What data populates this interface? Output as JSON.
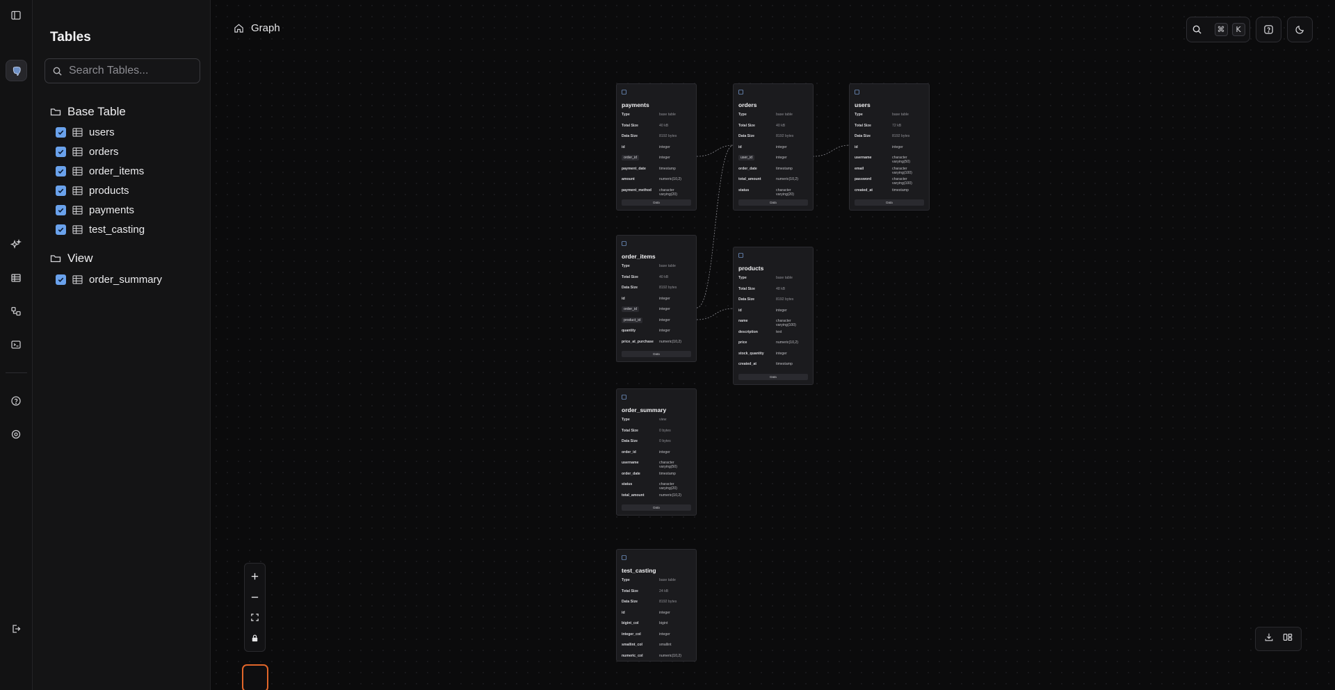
{
  "sidebar": {
    "title": "Tables",
    "search_placeholder": "Search Tables...",
    "groups": [
      {
        "label": "Base Table",
        "items": [
          "users",
          "orders",
          "order_items",
          "products",
          "payments",
          "test_casting"
        ]
      },
      {
        "label": "View",
        "items": [
          "order_summary"
        ]
      }
    ]
  },
  "rail": {
    "icons": [
      "sidebar-toggle-icon",
      "postgres-logo",
      "sparkles-icon",
      "table-icon",
      "schema-icon",
      "terminal-icon",
      "help-icon",
      "settings-icon",
      "logout-icon"
    ]
  },
  "breadcrumb": {
    "label": "Graph"
  },
  "toolbar": {
    "kbd_cmd": "⌘",
    "kbd_k": "K"
  },
  "nodes": {
    "payments": {
      "name": "payments",
      "rows": [
        [
          "Type",
          "base table"
        ],
        [
          "Total Size",
          "40 kB"
        ],
        [
          "Data Size",
          "8192 bytes"
        ],
        [
          "id",
          "integer"
        ],
        [
          "order_id",
          "integer"
        ],
        [
          "payment_date",
          "timestamp"
        ],
        [
          "amount",
          "numeric(10,2)"
        ],
        [
          "payment_method",
          "character varying(20)"
        ]
      ],
      "data_label": "Data"
    },
    "orders": {
      "name": "orders",
      "rows": [
        [
          "Type",
          "base table"
        ],
        [
          "Total Size",
          "40 kB"
        ],
        [
          "Data Size",
          "8192 bytes"
        ],
        [
          "id",
          "integer"
        ],
        [
          "user_id",
          "integer"
        ],
        [
          "order_date",
          "timestamp"
        ],
        [
          "total_amount",
          "numeric(10,2)"
        ],
        [
          "status",
          "character varying(20)"
        ]
      ],
      "data_label": "Data"
    },
    "users": {
      "name": "users",
      "rows": [
        [
          "Type",
          "base table"
        ],
        [
          "Total Size",
          "72 kB"
        ],
        [
          "Data Size",
          "8192 bytes"
        ],
        [
          "id",
          "integer"
        ],
        [
          "username",
          "character varying(50)"
        ],
        [
          "email",
          "character varying(100)"
        ],
        [
          "password",
          "character varying(100)"
        ],
        [
          "created_at",
          "timestamp"
        ]
      ],
      "data_label": "Data"
    },
    "order_items": {
      "name": "order_items",
      "rows": [
        [
          "Type",
          "base table"
        ],
        [
          "Total Size",
          "40 kB"
        ],
        [
          "Data Size",
          "8192 bytes"
        ],
        [
          "id",
          "integer"
        ],
        [
          "order_id",
          "integer"
        ],
        [
          "product_id",
          "integer"
        ],
        [
          "quantity",
          "integer"
        ],
        [
          "price_at_purchase",
          "numeric(10,2)"
        ]
      ],
      "data_label": "Data"
    },
    "products": {
      "name": "products",
      "rows": [
        [
          "Type",
          "base table"
        ],
        [
          "Total Size",
          "48 kB"
        ],
        [
          "Data Size",
          "8192 bytes"
        ],
        [
          "id",
          "integer"
        ],
        [
          "name",
          "character varying(100)"
        ],
        [
          "description",
          "text"
        ],
        [
          "price",
          "numeric(10,2)"
        ],
        [
          "stock_quantity",
          "integer"
        ],
        [
          "created_at",
          "timestamp"
        ]
      ],
      "data_label": "Data"
    },
    "order_summary": {
      "name": "order_summary",
      "rows": [
        [
          "Type",
          "view"
        ],
        [
          "Total Size",
          "0 bytes"
        ],
        [
          "Data Size",
          "0 bytes"
        ],
        [
          "order_id",
          "integer"
        ],
        [
          "username",
          "character varying(50)"
        ],
        [
          "order_date",
          "timestamp"
        ],
        [
          "status",
          "character varying(20)"
        ],
        [
          "total_amount",
          "numeric(10,2)"
        ]
      ],
      "data_label": "Data"
    },
    "test_casting": {
      "name": "test_casting",
      "rows": [
        [
          "Type",
          "base table"
        ],
        [
          "Total Size",
          "24 kB"
        ],
        [
          "Data Size",
          "8192 bytes"
        ],
        [
          "id",
          "integer"
        ],
        [
          "bigint_col",
          "bigint"
        ],
        [
          "integer_col",
          "integer"
        ],
        [
          "smallint_col",
          "smallint"
        ],
        [
          "numeric_col",
          "numeric(10,2)"
        ]
      ],
      "data_label": ""
    }
  },
  "colors": {
    "accent": "#6aa2ec",
    "minimap_border": "#e2662a"
  }
}
